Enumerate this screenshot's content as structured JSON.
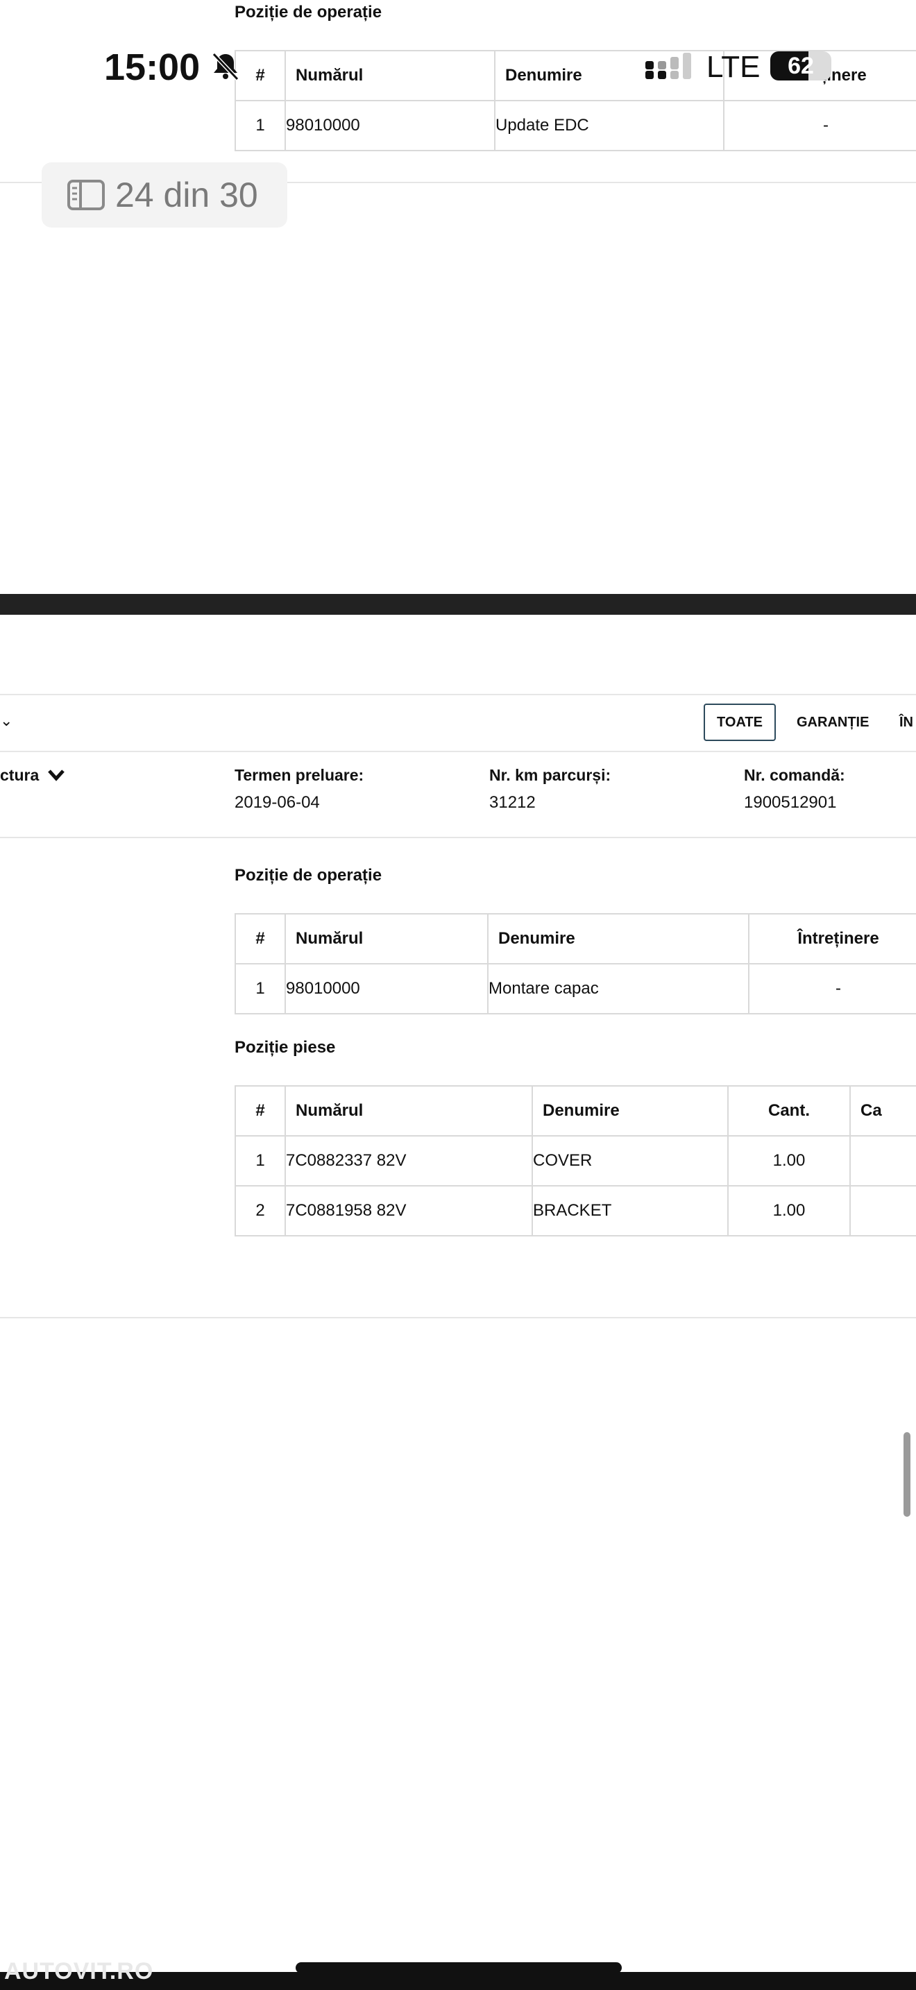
{
  "status_bar": {
    "time": "15:00",
    "network": "LTE",
    "battery": "62"
  },
  "photo_counter": "24 din 30",
  "section1": {
    "operations_title": "Poziție de operație",
    "headers": [
      "#",
      "Numărul",
      "Denumire",
      "Întreținere"
    ],
    "rows": [
      [
        "1",
        "98010000",
        "Update EDC",
        "-"
      ]
    ]
  },
  "section2": {
    "tabs": {
      "all": "TOATE",
      "warranty": "GARANȚIE",
      "partial": "ÎN"
    },
    "left_partial": "ctura",
    "meta": [
      {
        "label": "Termen preluare:",
        "value": "2019-06-04"
      },
      {
        "label": "Nr. km parcurși:",
        "value": "31212"
      },
      {
        "label": "Nr. comandă:",
        "value": "1900512901"
      }
    ],
    "operations_title": "Poziție de operație",
    "operations": {
      "headers": [
        "#",
        "Numărul",
        "Denumire",
        "Întreținere"
      ],
      "rows": [
        [
          "1",
          "98010000",
          "Montare capac",
          "-"
        ]
      ]
    },
    "parts_title": "Poziție piese",
    "parts": {
      "headers": [
        "#",
        "Numărul",
        "Denumire",
        "Cant.",
        "Ca"
      ],
      "rows": [
        [
          "1",
          "7C0882337 82V",
          "COVER",
          "1.00",
          ""
        ],
        [
          "2",
          "7C0881958 82V",
          "BRACKET",
          "1.00",
          ""
        ]
      ]
    }
  },
  "watermark": "AUTOVIT.RO"
}
